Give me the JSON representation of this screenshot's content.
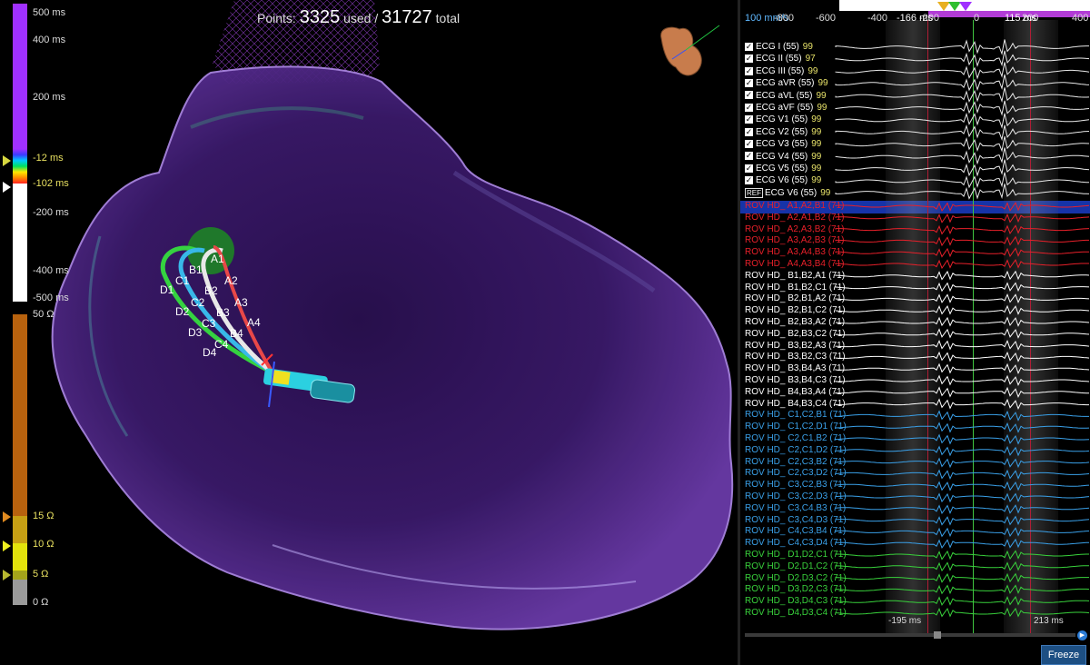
{
  "points": {
    "prefix": "Points:",
    "used": "3325",
    "used_label": "used /",
    "total": "31727",
    "total_label": "total"
  },
  "lat_scale": {
    "labels": [
      "500 ms",
      "400 ms",
      "200 ms",
      "-12 ms",
      "-102 ms",
      "-200 ms",
      "-400 ms",
      "-500 ms"
    ],
    "colors": {
      "top": "#a030ff",
      "mid": "#ffffff"
    }
  },
  "imp_scale": {
    "labels": [
      "50 Ω",
      "15 Ω",
      "10 Ω",
      "5 Ω",
      "0 Ω"
    ],
    "colors": {
      "upper": "#b8620e",
      "yellow": "#e2e20c",
      "olive": "#a3a31b",
      "gray": "#9a9a9a"
    }
  },
  "catheter": {
    "labels": [
      "A1",
      "A2",
      "A3",
      "A4",
      "B1",
      "B2",
      "B3",
      "B4",
      "C1",
      "C2",
      "C3",
      "C4",
      "D1",
      "D2",
      "D3",
      "D4"
    ]
  },
  "header": {
    "speed": "100 mm/s",
    "axis": [
      "-800",
      "-600",
      "-400",
      "-200",
      "0",
      "200",
      "400"
    ],
    "window_left": "-166 ms",
    "window_right": "115 ms"
  },
  "ecg_channels": [
    {
      "name": "ECG I (55)",
      "gain": "99"
    },
    {
      "name": "ECG II (55)",
      "gain": "97"
    },
    {
      "name": "ECG III (55)",
      "gain": "99"
    },
    {
      "name": "ECG aVR (55)",
      "gain": "99"
    },
    {
      "name": "ECG aVL (55)",
      "gain": "99"
    },
    {
      "name": "ECG aVF (55)",
      "gain": "99"
    },
    {
      "name": "ECG V1 (55)",
      "gain": "99"
    },
    {
      "name": "ECG V2 (55)",
      "gain": "99"
    },
    {
      "name": "ECG V3 (55)",
      "gain": "99"
    },
    {
      "name": "ECG V4 (55)",
      "gain": "99"
    },
    {
      "name": "ECG V5 (55)",
      "gain": "99"
    },
    {
      "name": "ECG V6 (55)",
      "gain": "99"
    }
  ],
  "ref_channel": {
    "tag": "REF",
    "name": "ECG V6 (55)",
    "gain": "99"
  },
  "egm_channels": [
    {
      "name": "ROV HD_ A1,A2,B1 (71)",
      "color": "#e8202a"
    },
    {
      "name": "ROV HD_ A2,A1,B2 (71)",
      "color": "#e8202a"
    },
    {
      "name": "ROV HD_ A2,A3,B2 (71)",
      "color": "#e8202a"
    },
    {
      "name": "ROV HD_ A3,A2,B3 (71)",
      "color": "#e8202a"
    },
    {
      "name": "ROV HD_ A3,A4,B3 (71)",
      "color": "#e8202a"
    },
    {
      "name": "ROV HD_ A4,A3,B4 (71)",
      "color": "#e8202a"
    },
    {
      "name": "ROV HD_ B1,B2,A1 (71)",
      "color": "#ffffff"
    },
    {
      "name": "ROV HD_ B1,B2,C1 (71)",
      "color": "#ffffff"
    },
    {
      "name": "ROV HD_ B2,B1,A2 (71)",
      "color": "#ffffff"
    },
    {
      "name": "ROV HD_ B2,B1,C2 (71)",
      "color": "#ffffff"
    },
    {
      "name": "ROV HD_ B2,B3,A2 (71)",
      "color": "#ffffff"
    },
    {
      "name": "ROV HD_ B2,B3,C2 (71)",
      "color": "#ffffff"
    },
    {
      "name": "ROV HD_ B3,B2,A3 (71)",
      "color": "#ffffff"
    },
    {
      "name": "ROV HD_ B3,B2,C3 (71)",
      "color": "#ffffff"
    },
    {
      "name": "ROV HD_ B3,B4,A3 (71)",
      "color": "#ffffff"
    },
    {
      "name": "ROV HD_ B3,B4,C3 (71)",
      "color": "#ffffff"
    },
    {
      "name": "ROV HD_ B4,B3,A4 (71)",
      "color": "#ffffff"
    },
    {
      "name": "ROV HD_ B4,B3,C4 (71)",
      "color": "#ffffff"
    },
    {
      "name": "ROV HD_ C1,C2,B1 (71)",
      "color": "#3aa0e8"
    },
    {
      "name": "ROV HD_ C1,C2,D1 (71)",
      "color": "#3aa0e8"
    },
    {
      "name": "ROV HD_ C2,C1,B2 (71)",
      "color": "#3aa0e8"
    },
    {
      "name": "ROV HD_ C2,C1,D2 (71)",
      "color": "#3aa0e8"
    },
    {
      "name": "ROV HD_ C2,C3,B2 (71)",
      "color": "#3aa0e8"
    },
    {
      "name": "ROV HD_ C2,C3,D2 (71)",
      "color": "#3aa0e8"
    },
    {
      "name": "ROV HD_ C3,C2,B3 (71)",
      "color": "#3aa0e8"
    },
    {
      "name": "ROV HD_ C3,C2,D3 (71)",
      "color": "#3aa0e8"
    },
    {
      "name": "ROV HD_ C3,C4,B3 (71)",
      "color": "#3aa0e8"
    },
    {
      "name": "ROV HD_ C3,C4,D3 (71)",
      "color": "#3aa0e8"
    },
    {
      "name": "ROV HD_ C4,C3,B4 (71)",
      "color": "#3aa0e8"
    },
    {
      "name": "ROV HD_ C4,C3,D4 (71)",
      "color": "#3aa0e8"
    },
    {
      "name": "ROV HD_ D1,D2,C1 (71)",
      "color": "#39d23c"
    },
    {
      "name": "ROV HD_ D2,D1,C2 (71)",
      "color": "#39d23c"
    },
    {
      "name": "ROV HD_ D2,D3,C2 (71)",
      "color": "#39d23c"
    },
    {
      "name": "ROV HD_ D3,D2,C3 (71)",
      "color": "#39d23c"
    },
    {
      "name": "ROV HD_ D3,D4,C3 (71)",
      "color": "#39d23c"
    },
    {
      "name": "ROV HD_ D4,D3,C4 (71)",
      "color": "#39d23c"
    }
  ],
  "footer": {
    "left_ms": "-195 ms",
    "right_ms": "213 ms",
    "freeze": "Freeze"
  }
}
